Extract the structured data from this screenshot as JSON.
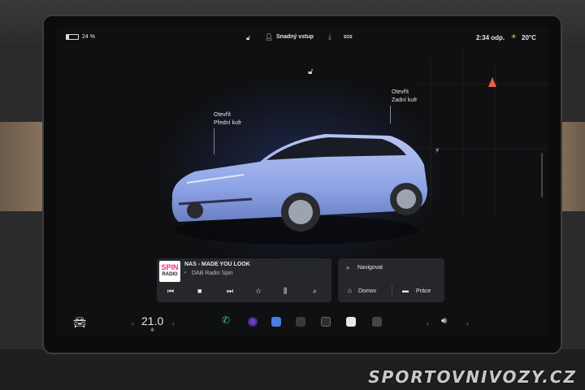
{
  "status": {
    "battery_percent": "24 %",
    "battery_level": 0.24,
    "profile_label": "Snadný vstup",
    "time": "2:34 odp.",
    "outside_temp": "20°C",
    "sos_label": "SOS"
  },
  "car_view": {
    "front_trunk_line1": "Otevřít",
    "front_trunk_line2": "Přední kufr",
    "rear_trunk_line1": "Otevřít",
    "rear_trunk_line2": "Zadní kufr"
  },
  "media": {
    "logo_line1": "SPIN",
    "logo_line2": "RADIO",
    "track": "NAS - MADE YOU LOOK",
    "station": "DAB Radio Spin"
  },
  "navigation": {
    "search_label": "Navigovat",
    "home_label": "Domov",
    "work_label": "Práce"
  },
  "dock": {
    "cabin_temp": "21.0",
    "colors": {
      "phone": "#43c26a",
      "accent_red": "#e85c4a",
      "download": "#e8902a"
    }
  }
}
